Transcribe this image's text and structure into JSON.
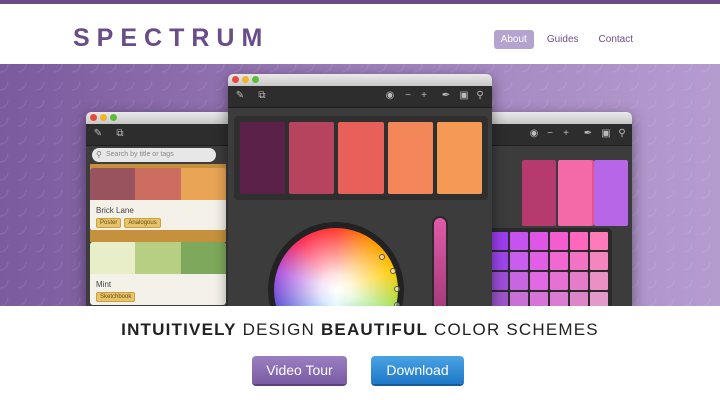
{
  "header": {
    "logo": "SPECTRUM",
    "nav": [
      {
        "label": "About",
        "active": true
      },
      {
        "label": "Guides",
        "active": false
      },
      {
        "label": "Contact",
        "active": false
      }
    ]
  },
  "hero": {
    "left_window": {
      "search_placeholder": "Search by title or tags",
      "cards": [
        {
          "name": "Brick Lane",
          "colors": [
            "#98535e",
            "#cc6d5f",
            "#e9a456"
          ],
          "tags": [
            "Poster",
            "Analogous"
          ]
        },
        {
          "name": "Mint",
          "colors": [
            "#e8efc8",
            "#b7cf83",
            "#7ea85b"
          ],
          "tags": [
            "Sketchbook"
          ]
        }
      ]
    },
    "center_window": {
      "palette": [
        "#5b2149",
        "#b6445f",
        "#e8605a",
        "#f4875a",
        "#f49a55"
      ]
    },
    "right_window": {
      "swatches": [
        "#b73a6f",
        "#e5528d",
        "#f46aa9",
        "#b866e8"
      ],
      "grid_colors": [
        "#9b3df0",
        "#c653f0",
        "#df55e6",
        "#f35dcf",
        "#ff67bf",
        "#ff7ab8"
      ]
    }
  },
  "tagline": {
    "part1": "INTUITIVELY",
    "part2": " DESIGN ",
    "part3": "BEAUTIFUL",
    "part4": " COLOR SCHEMES"
  },
  "buttons": {
    "video_tour": "Video Tour",
    "download": "Download"
  },
  "colors": {
    "brand": "#6a4c88",
    "nav_active_bg": "#b5a3cf",
    "button_purple": "#8a6db4",
    "button_blue": "#2b8ad6"
  }
}
